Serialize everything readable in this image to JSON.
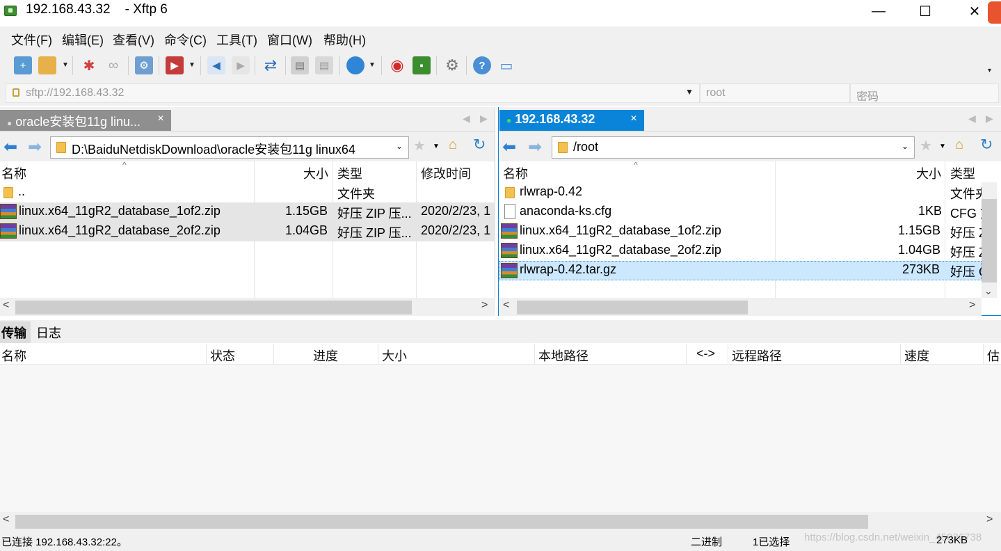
{
  "window": {
    "title": "192.168.43.32    - Xftp 6",
    "minimize_glyph": "—",
    "maximize_glyph": "☐",
    "close_glyph": "✕"
  },
  "menu": [
    "文件(F)",
    "编辑(E)",
    "查看(V)",
    "命令(C)",
    "工具(T)",
    "窗口(W)",
    "帮助(H)"
  ],
  "toolbar": {
    "icons": [
      "new-session-icon",
      "open-folder-icon",
      "disconnect-icon",
      "reconnect-icon",
      "properties-icon",
      "play-icon",
      "upload-icon",
      "download-icon",
      "sync-icon",
      "copy-icon",
      "paste-icon",
      "globe-icon",
      "xshell-icon",
      "xftp-icon",
      "settings-icon",
      "help-icon",
      "chat-icon"
    ],
    "overflow_glyph": "▾"
  },
  "address": {
    "url": "sftp://192.168.43.32",
    "user": "root",
    "password_placeholder": "密码"
  },
  "left_pane": {
    "tab_label": "oracle安装包11g linu...",
    "path": "D:\\BaiduNetdiskDownload\\oracle安装包11g linux64",
    "columns": [
      "名称",
      "大小",
      "类型",
      "修改时间"
    ],
    "rows": [
      {
        "name": "..",
        "size": "",
        "type": "文件夹",
        "modified": "",
        "icon": "folder"
      },
      {
        "name": "linux.x64_11gR2_database_1of2.zip",
        "size": "1.15GB",
        "type": "好压 ZIP 压...",
        "modified": "2020/2/23, 1",
        "icon": "zip"
      },
      {
        "name": "linux.x64_11gR2_database_2of2.zip",
        "size": "1.04GB",
        "type": "好压 ZIP 压...",
        "modified": "2020/2/23, 1",
        "icon": "zip"
      }
    ]
  },
  "right_pane": {
    "tab_label": "192.168.43.32",
    "path": "/root",
    "columns": [
      "名称",
      "大小",
      "类型"
    ],
    "rows": [
      {
        "name": "rlwrap-0.42",
        "size": "",
        "type": "文件夹",
        "icon": "folder"
      },
      {
        "name": "anaconda-ks.cfg",
        "size": "1KB",
        "type": "CFG 文",
        "icon": "file"
      },
      {
        "name": "linux.x64_11gR2_database_1of2.zip",
        "size": "1.15GB",
        "type": "好压 Z",
        "icon": "zip"
      },
      {
        "name": "linux.x64_11gR2_database_2of2.zip",
        "size": "1.04GB",
        "type": "好压 Z",
        "icon": "zip"
      },
      {
        "name": "rlwrap-0.42.tar.gz",
        "size": "273KB",
        "type": "好压 G",
        "icon": "zip"
      }
    ]
  },
  "transfer": {
    "tabs": [
      "传输",
      "日志"
    ],
    "columns": [
      "名称",
      "状态",
      "进度",
      "大小",
      "本地路径",
      "<->",
      "远程路径",
      "速度",
      "估"
    ]
  },
  "status": {
    "connection": "已连接 192.168.43.32:22。",
    "mode": "二进制",
    "selection": "1已选择",
    "watermark": "https://blog.csdn.net/weixin_45026738",
    "size": "273KB"
  },
  "colors": {
    "active_tab": "#0a84d8",
    "selection": "#cce8ff",
    "highlight_rows": "#e5e5e5"
  }
}
